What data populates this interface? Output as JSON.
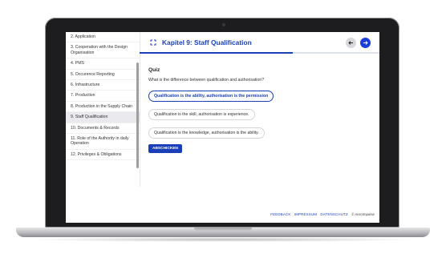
{
  "sidebar": {
    "items": [
      {
        "label": "2. Application"
      },
      {
        "label": "3. Cooperation with the Design Organisation"
      },
      {
        "label": "4. PMS"
      },
      {
        "label": "5. Occurence Reporting"
      },
      {
        "label": "6. Infrastructure"
      },
      {
        "label": "7. Production"
      },
      {
        "label": "8. Production in the Supply Chain"
      },
      {
        "label": "9. Staff Qualification",
        "active": true
      },
      {
        "label": "10. Documents & Records"
      },
      {
        "label": "11. Role of the Authority in daily Operation"
      },
      {
        "label": "12. Privileges & Obligations"
      }
    ]
  },
  "header": {
    "title": "Kapitel 9: Staff Qualification",
    "drag_icon": "drag-handle-icon",
    "prev_icon": "arrow-left-icon",
    "next_icon": "arrow-right-icon",
    "progress": 0.64
  },
  "quiz": {
    "title": "Quiz",
    "question": "What is the difference between qualification and authorisation?",
    "options": [
      {
        "label": "Qualification is the ability, authorisation is the permission",
        "selected": true
      },
      {
        "label": "Qualification is the skill, authorisation is experience.",
        "selected": false
      },
      {
        "label": "Qualification is the knowledge, authorisation is the ability.",
        "selected": false
      }
    ],
    "submit_label": "ABSCHICKEN"
  },
  "footer": {
    "links": [
      "FEEDBACK",
      "IMPRESSUM",
      "DATENSCHUTZ"
    ],
    "copyright": "© AeroImpulse"
  },
  "colors": {
    "accent": "#1a3fb8",
    "next_button": "#1a3fd8",
    "laptop_bezel": "#1d1d1f"
  }
}
